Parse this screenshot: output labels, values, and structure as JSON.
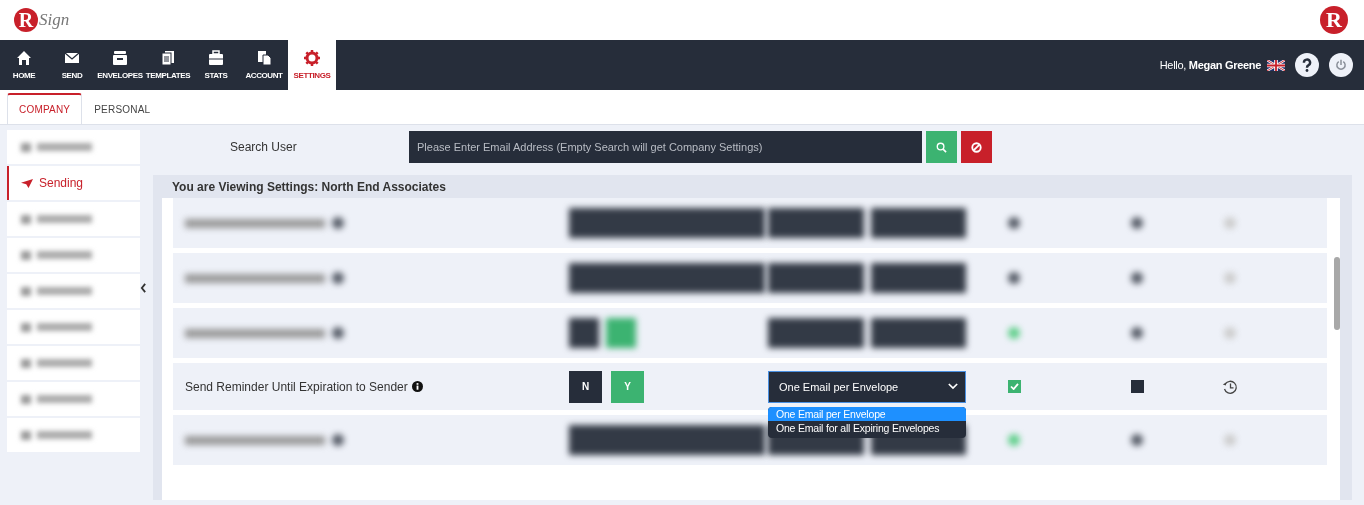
{
  "logo": {
    "letter": "R",
    "word": "Sign"
  },
  "corner_logo": {
    "letter": "R"
  },
  "nav": [
    {
      "label": "HOME",
      "kind": "home",
      "selected": false
    },
    {
      "label": "SEND",
      "kind": "mail",
      "selected": false
    },
    {
      "label": "ENVELOPES",
      "kind": "tray",
      "selected": false
    },
    {
      "label": "TEMPLATES",
      "kind": "docs",
      "selected": false
    },
    {
      "label": "STATS",
      "kind": "case",
      "selected": false
    },
    {
      "label": "ACCOUNT",
      "kind": "copy",
      "selected": false
    },
    {
      "label": "SETTINGS",
      "kind": "gear",
      "selected": true
    }
  ],
  "greeting": "Hello, **Megan Greene**",
  "tabs": [
    {
      "label": "COMPANY",
      "selected": true
    },
    {
      "label": "PERSONAL",
      "selected": false
    }
  ],
  "sidebar": {
    "items": [
      {
        "kind": "blurred"
      },
      {
        "kind": "link",
        "label": "Sending",
        "selected": true
      },
      {
        "kind": "blurred"
      },
      {
        "kind": "blurred"
      },
      {
        "kind": "blurred"
      },
      {
        "kind": "blurred"
      },
      {
        "kind": "blurred"
      },
      {
        "kind": "blurred"
      },
      {
        "kind": "blurred"
      }
    ]
  },
  "search": {
    "label": "Search User",
    "placeholder": "Please Enter Email Address (Empty Search will get Company Settings)"
  },
  "panel": {
    "title": "You are Viewing Settings: North End Associates"
  },
  "rows": [
    {
      "kind": "blurred_select",
      "checked": false
    },
    {
      "kind": "blurred_select",
      "checked": false
    },
    {
      "kind": "blurred_toggle",
      "checked": true
    },
    {
      "kind": "setting",
      "label": "Send Reminder Until Expiration to Sender",
      "toggle": [
        {
          "label": "N",
          "selected": false
        },
        {
          "label": "Y",
          "selected": true
        }
      ],
      "select": {
        "value": "One Email per Envelope",
        "expanded": true,
        "options": [
          {
            "label": "One Email per Envelope",
            "selected": true
          },
          {
            "label": "One Email for all Expiring Envelopes",
            "selected": false
          }
        ]
      },
      "checkbox_1": {
        "checked": true
      },
      "checkbox_2": {
        "checked": false
      }
    },
    {
      "kind": "blurred_select",
      "checked": true
    }
  ]
}
